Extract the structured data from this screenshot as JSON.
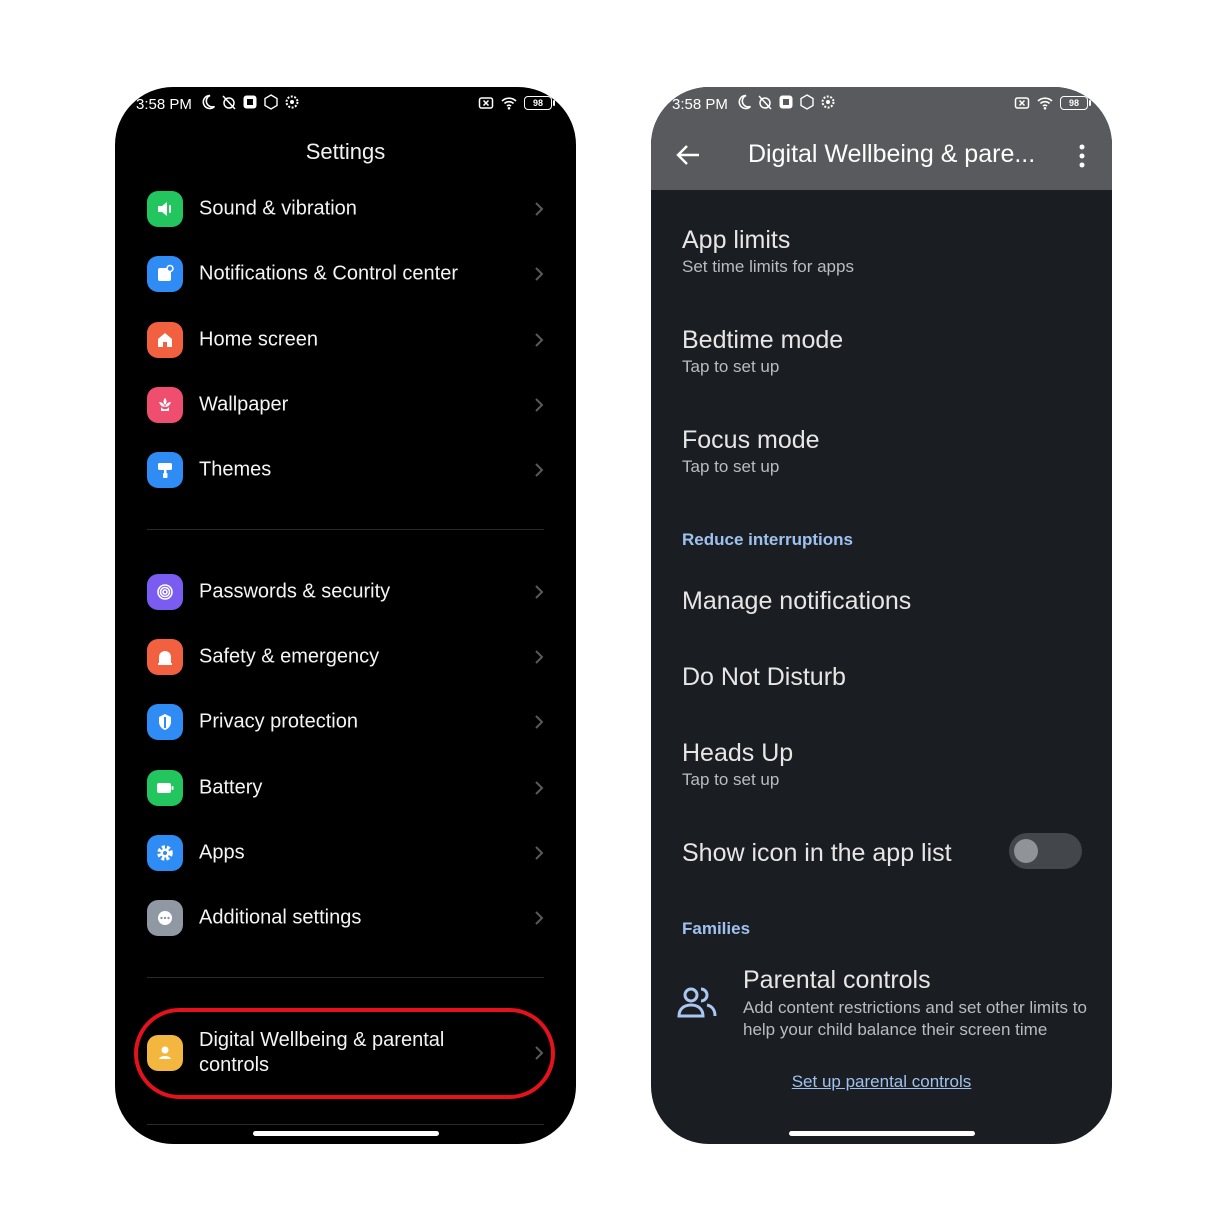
{
  "status_bar": {
    "time": "3:58 PM",
    "battery": "98",
    "icons": [
      "moon-icon",
      "alarm-off-icon",
      "notification-square-icon",
      "nfc-icon",
      "settings-gear-icon",
      "sim-x-icon",
      "wifi-icon",
      "battery-icon"
    ]
  },
  "left": {
    "title": "Settings",
    "items": [
      {
        "label": "Sound & vibration",
        "icon": "speaker-icon",
        "color": "#22c55e"
      },
      {
        "label": "Notifications & Control center",
        "icon": "notification-icon",
        "color": "#2f8cf5"
      },
      {
        "label": "Home screen",
        "icon": "home-icon",
        "color": "#f2613f"
      },
      {
        "label": "Wallpaper",
        "icon": "flower-icon",
        "color": "#ef4e6e"
      },
      {
        "label": "Themes",
        "icon": "paint-roller-icon",
        "color": "#2f8cf5"
      },
      {
        "label": "Passwords & security",
        "icon": "fingerprint-icon",
        "color": "#7a5cf0"
      },
      {
        "label": "Safety & emergency",
        "icon": "emergency-icon",
        "color": "#f2613f"
      },
      {
        "label": "Privacy protection",
        "icon": "shield-icon",
        "color": "#2f8cf5"
      },
      {
        "label": "Battery",
        "icon": "battery-icon",
        "color": "#22c55e"
      },
      {
        "label": "Apps",
        "icon": "gear-icon",
        "color": "#2f8cf5"
      },
      {
        "label": "Additional settings",
        "icon": "dots-icon",
        "color": "#8f98a3"
      }
    ],
    "highlight_item": {
      "label_line1": "Digital Wellbeing & parental",
      "label_line2": "controls",
      "icon": "person-icon",
      "color": "#f3b63f"
    }
  },
  "right": {
    "title": "Digital Wellbeing & pare...",
    "items": [
      {
        "title": "App limits",
        "sub": "Set time limits for apps"
      },
      {
        "title": "Bedtime mode",
        "sub": "Tap to set up"
      },
      {
        "title": "Focus mode",
        "sub": "Tap to set up"
      }
    ],
    "section_reduce": "Reduce interruptions",
    "items2": [
      {
        "title": "Manage notifications"
      },
      {
        "title": "Do Not Disturb"
      },
      {
        "title": "Heads Up",
        "sub": "Tap to set up"
      }
    ],
    "toggle_item": {
      "title": "Show icon in the app list",
      "enabled": false
    },
    "section_families": "Families",
    "parental": {
      "title": "Parental controls",
      "desc_line1": "Add content restrictions and set other limits to",
      "desc_line2": "help your child balance their screen time"
    },
    "link": "Set up parental controls"
  }
}
